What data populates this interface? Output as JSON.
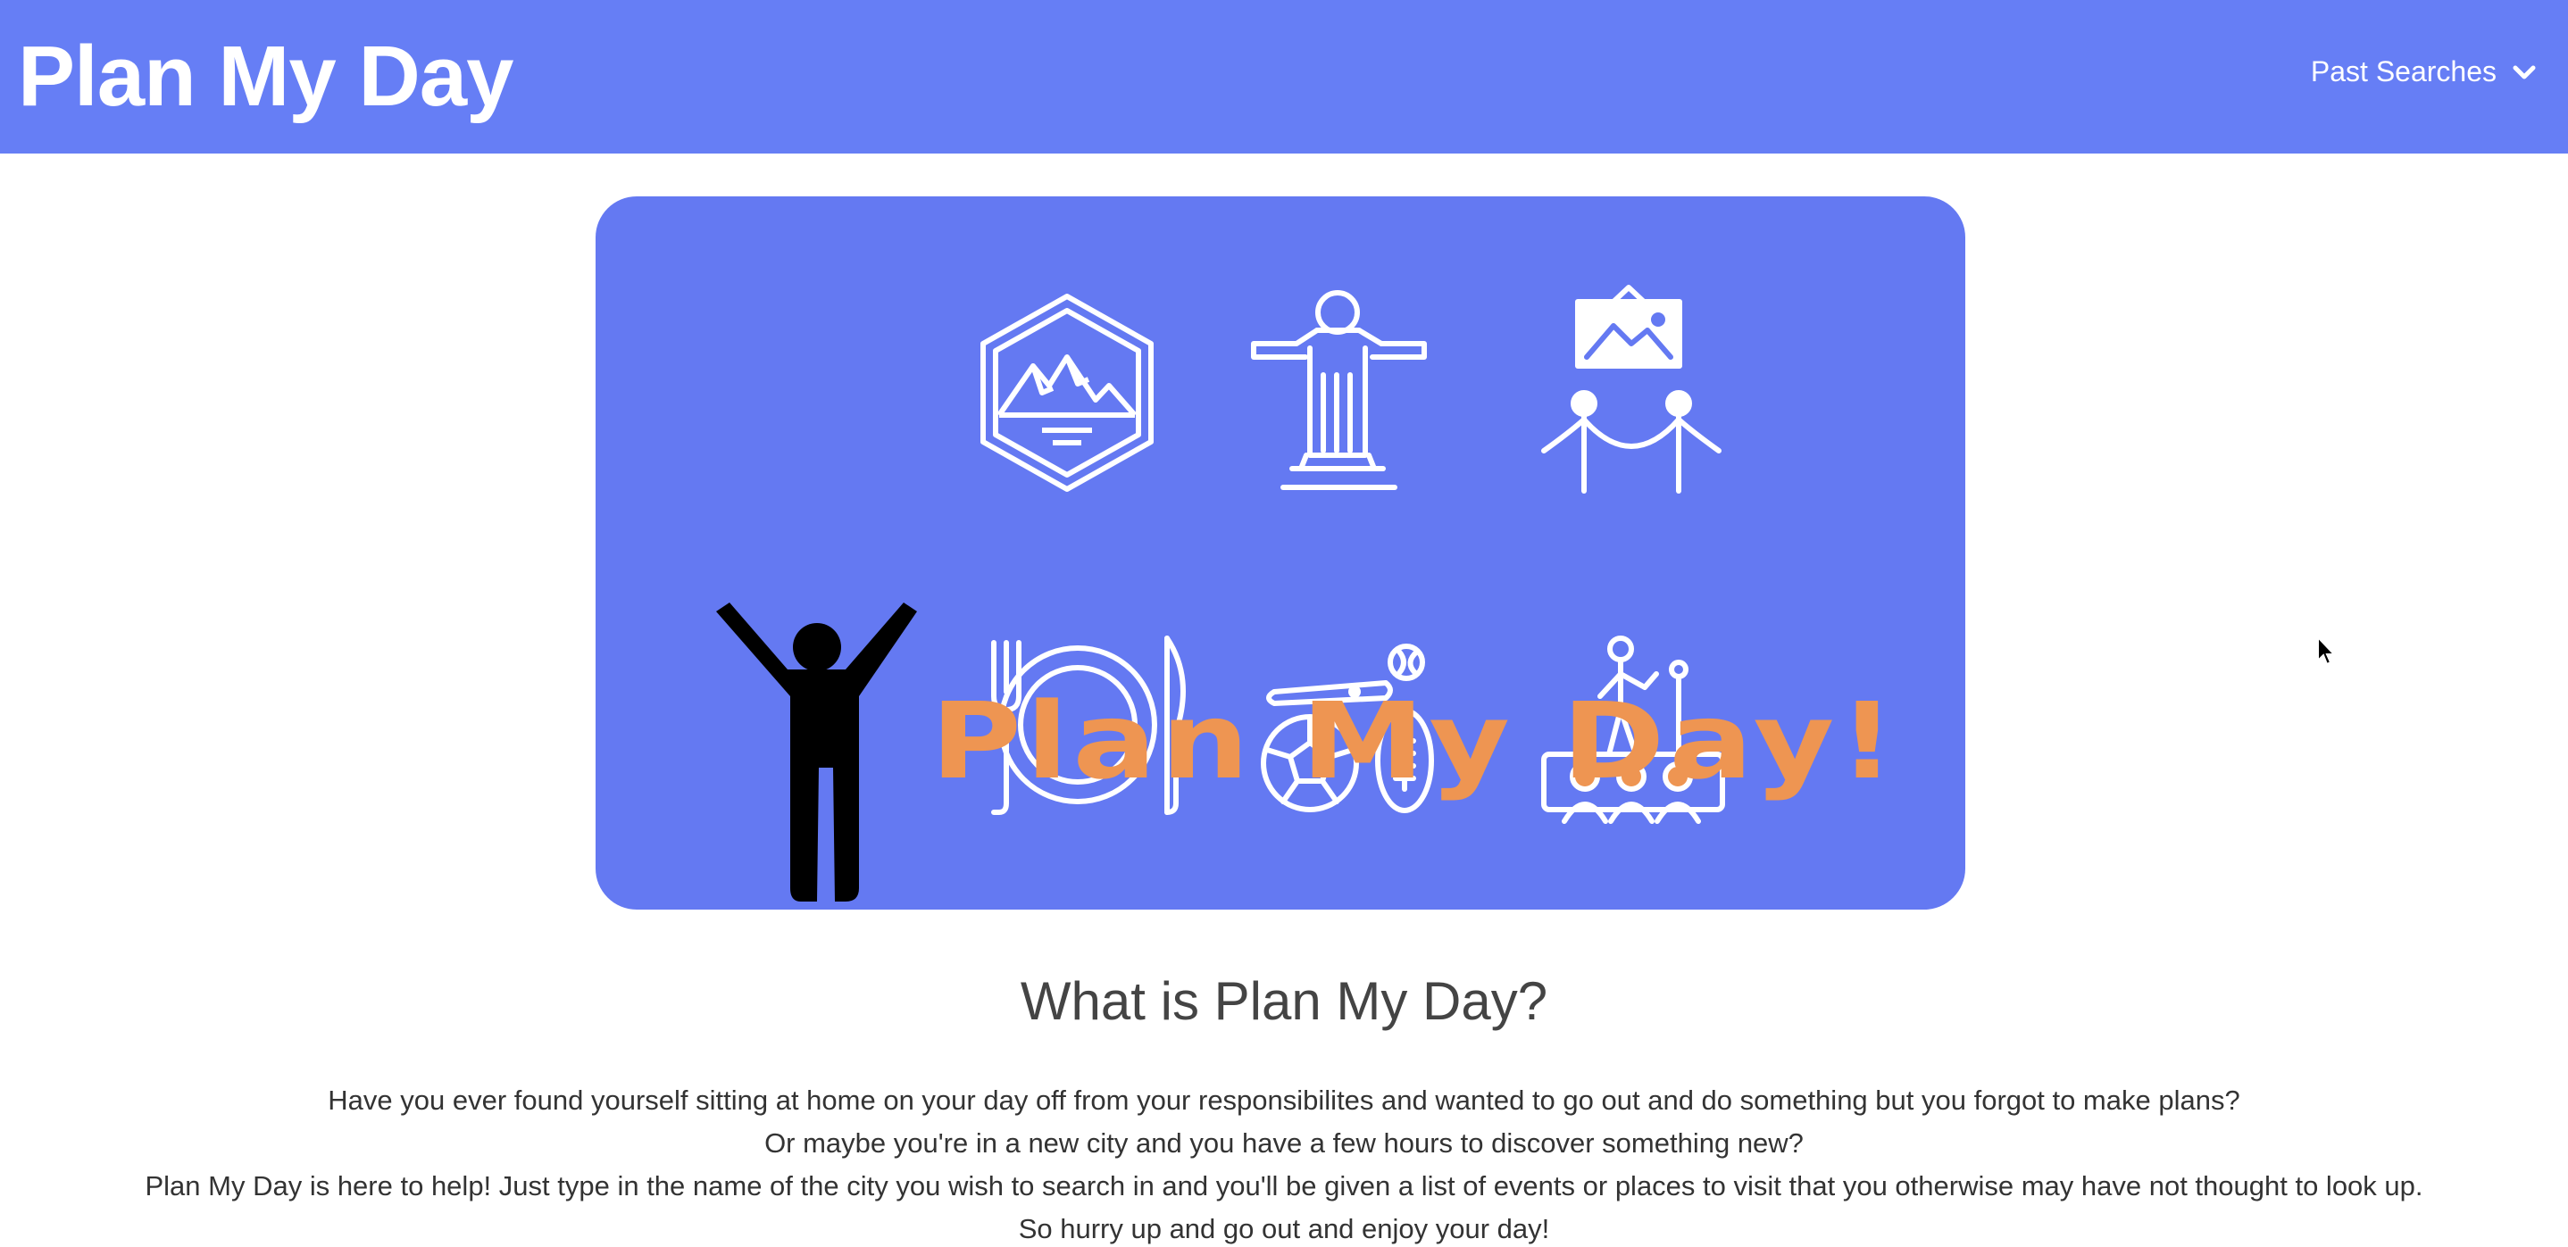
{
  "navbar": {
    "brand": "Plan My Day",
    "past_searches_label": "Past Searches",
    "dropdown_icon": "chevron-down-icon",
    "background_color": "#667ef5"
  },
  "hero": {
    "wordmark": "Plan My Day!",
    "background_color": "#6479f2",
    "wordmark_color": "#ee9552",
    "icons": [
      "mountain-badge-icon",
      "statue-icon",
      "museum-exhibit-icon",
      "person-celebrating-icon",
      "dining-icon",
      "sports-icon",
      "concert-stage-icon"
    ]
  },
  "main": {
    "heading": "What is Plan My Day?",
    "paragraphs": [
      "Have you ever found yourself sitting at home on your day off from your responsibilites and wanted to go out and do something but you forgot to make plans?",
      "Or maybe you're in a new city and you have a few hours to discover something new?",
      "Plan My Day is here to help! Just type in the name of the city you wish to search in and you'll be given a list of events or places to visit that you otherwise may have not thought to look up.",
      "So hurry up and go out and enjoy your day!"
    ]
  }
}
